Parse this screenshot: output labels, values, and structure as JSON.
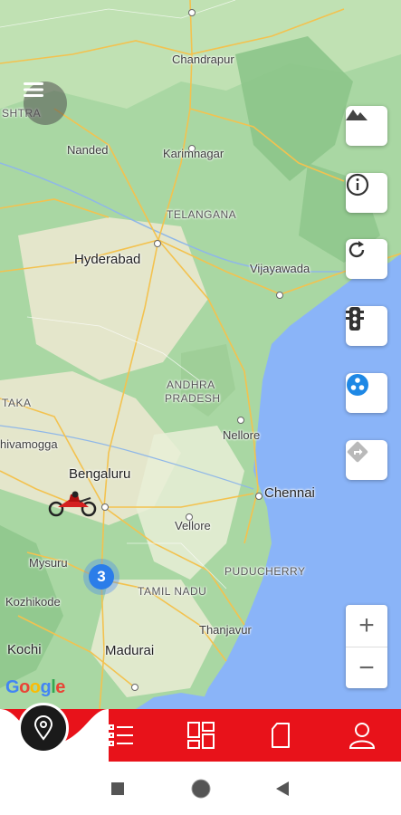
{
  "map": {
    "labels": {
      "chandrapur": "Chandrapur",
      "shtra": "SHTRA",
      "nanded": "Nanded",
      "karimnagar": "Karimnagar",
      "telangana": "TELANGANA",
      "hyderabad": "Hyderabad",
      "vijayawada": "Vijayawada",
      "andhra1": "ANDHRA",
      "andhra2": "PRADESH",
      "taka": "TAKA",
      "shivamogga": "hivamogga",
      "nellore": "Nellore",
      "bengaluru": "Bengaluru",
      "chennai": "Chennai",
      "vellore": "Vellore",
      "mysuru": "Mysuru",
      "puducherry": "PUDUCHERRY",
      "tamilnadu": "TAMIL NADU",
      "kozhikode": "Kozhikode",
      "thanjavur": "Thanjavur",
      "kochi": "Kochi",
      "madurai": "Madurai"
    },
    "cluster_count": "3",
    "attribution": "Google",
    "colors": {
      "land": "#a9d7a3",
      "sea": "#8ab4f8",
      "accent": "#e8121a",
      "cluster": "#2b7de9"
    }
  },
  "controls": {
    "terrain": "terrain-icon",
    "info": "info-icon",
    "refresh": "refresh-icon",
    "traffic": "traffic-light-icon",
    "layers": "layers-icon",
    "directions": "directions-icon",
    "zoom_in": "+",
    "zoom_out": "−"
  },
  "tabs": [
    "location-pin-icon",
    "list-icon",
    "dashboard-icon",
    "document-icon",
    "profile-icon"
  ],
  "system_nav": [
    "square-icon",
    "circle-icon",
    "back-triangle-icon"
  ]
}
